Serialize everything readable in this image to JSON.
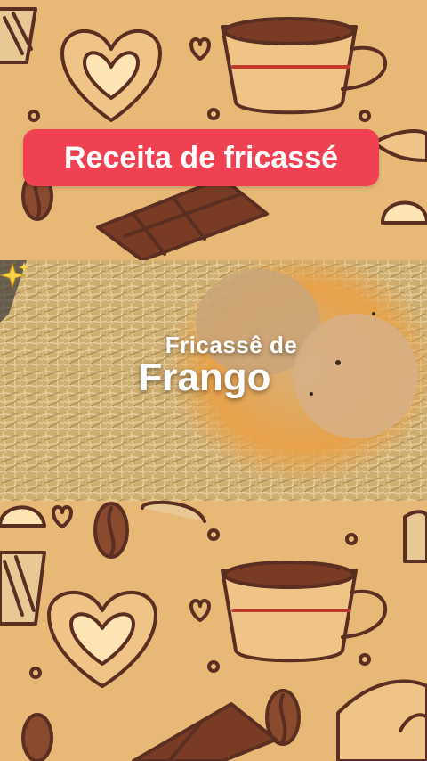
{
  "banner": {
    "title": "Receita de fricassé"
  },
  "video": {
    "overlay_line1": "Fricassê de",
    "overlay_line2": "Frango",
    "sparkle_icon": "sparkle-icon"
  },
  "colors": {
    "background": "#e8b877",
    "doodle_stroke": "#5a2e20",
    "banner": "#f04152",
    "banner_text": "#ffffff"
  }
}
